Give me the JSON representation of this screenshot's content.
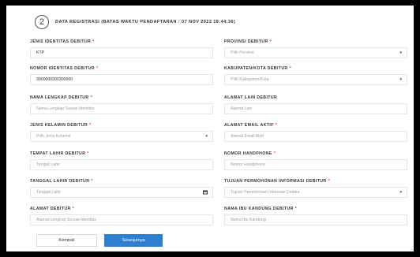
{
  "header": {
    "step_number": "2",
    "title": "DATA REGISTRASI (BATAS WAKTU PENDAFTARAN : 07 NOV 2022 18:44:36)"
  },
  "left_fields": [
    {
      "label": "JENIS IDENTITAS DEBITUR",
      "required": "*",
      "value": "KTP",
      "filled": true
    },
    {
      "label": "NOMOR IDENTITAS DEBITUR",
      "required": "*",
      "value": "3000000000300000",
      "filled": true
    },
    {
      "label": "NAMA LENGKAP DEBITUR",
      "required": "*",
      "value": "Nama Lengkap Sesuai Identitas"
    },
    {
      "label": "JENIS KELAMIN DEBITUR",
      "required": "*",
      "value": "Pilih Jenis Kelamin",
      "dropdown": true
    },
    {
      "label": "TEMPAT LAHIR DEBITUR",
      "required": "*",
      "value": "Tempat Lahir"
    },
    {
      "label": "TANGGAL LAHIR DEBITUR",
      "required": "*",
      "value": "Tanggal Lahir",
      "date": true
    },
    {
      "label": "ALAMAT DEBITUR",
      "required": "*",
      "value": "Alamat Lengkap Sesuai Identitas"
    }
  ],
  "right_fields": [
    {
      "label": "PROVINSI DEBITUR",
      "required": "*",
      "value": "Pilih Provinsi",
      "dropdown": true
    },
    {
      "label": "KABUPATEN/KOTA DEBITUR",
      "required": "*",
      "value": "Pilih Kabupaten/Kota",
      "dropdown": true
    },
    {
      "label": "ALAMAT LAIN DEBITUR",
      "required": "",
      "value": "Alamat Lain"
    },
    {
      "label": "ALAMAT EMAIL AKTIF",
      "required": "*",
      "value": "Alamat Email Aktif"
    },
    {
      "label": "NOMOR HANDPHONE",
      "required": "*",
      "value": "Nomor Handphone"
    },
    {
      "label": "TUJUAN PERMOHONAN INFORMASI DEBITUR",
      "required": "*",
      "value": "Tujuan Permohonan Informasi Debitur",
      "dropdown": true
    },
    {
      "label": "NAMA IBU KANDUNG DEBITUR",
      "required": "*",
      "value": "Nama Ibu Kandung"
    }
  ],
  "buttons": {
    "back_label": "Kembali",
    "next_label": "Selanjutnya"
  },
  "colors": {
    "primary": "#2f7fd1",
    "required": "#e53935"
  }
}
